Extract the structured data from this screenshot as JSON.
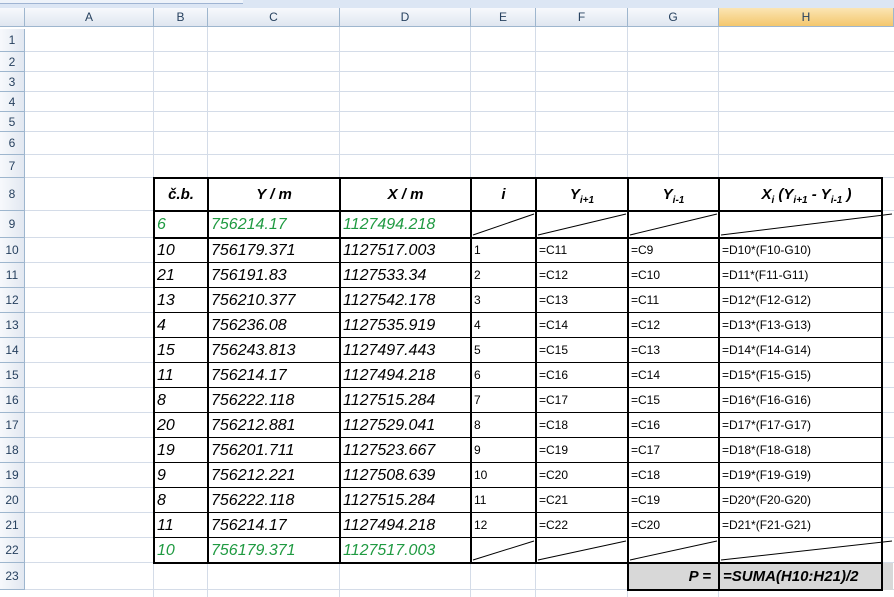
{
  "columns": [
    "A",
    "B",
    "C",
    "D",
    "E",
    "F",
    "G",
    "H"
  ],
  "selected_column": "H",
  "rows": [
    "1",
    "2",
    "3",
    "4",
    "5",
    "6",
    "7",
    "8",
    "9",
    "10",
    "11",
    "12",
    "13",
    "14",
    "15",
    "16",
    "17",
    "18",
    "19",
    "20",
    "21",
    "22",
    "23"
  ],
  "table": {
    "header": {
      "cb": "č.b.",
      "y": "Y / m",
      "x": "X / m",
      "i": "i",
      "yi1_main": "Y",
      "yi1_sub": "i+1",
      "yim1_main": "Y",
      "yim1_sub": "i-1",
      "h_xi": "X",
      "h_xi_sub": "i",
      "h_open": " (Y",
      "h_sub1": "i+1",
      "h_mid": " - Y",
      "h_sub2": "i-1",
      "h_close": " )"
    },
    "data_rows": [
      {
        "cb": "6",
        "y": "756214.17",
        "x": "1127494.218",
        "i": "",
        "f": "",
        "g": "",
        "h": "",
        "green": true
      },
      {
        "cb": "10",
        "y": "756179.371",
        "x": "1127517.003",
        "i": "1",
        "f": "=C11",
        "g": "=C9",
        "h": "=D10*(F10-G10)"
      },
      {
        "cb": "21",
        "y": "756191.83",
        "x": "1127533.34",
        "i": "2",
        "f": "=C12",
        "g": "=C10",
        "h": "=D11*(F11-G11)"
      },
      {
        "cb": "13",
        "y": "756210.377",
        "x": "1127542.178",
        "i": "3",
        "f": "=C13",
        "g": "=C11",
        "h": "=D12*(F12-G12)"
      },
      {
        "cb": "4",
        "y": "756236.08",
        "x": "1127535.919",
        "i": "4",
        "f": "=C14",
        "g": "=C12",
        "h": "=D13*(F13-G13)"
      },
      {
        "cb": "15",
        "y": "756243.813",
        "x": "1127497.443",
        "i": "5",
        "f": "=C15",
        "g": "=C13",
        "h": "=D14*(F14-G14)"
      },
      {
        "cb": "11",
        "y": "756214.17",
        "x": "1127494.218",
        "i": "6",
        "f": "=C16",
        "g": "=C14",
        "h": "=D15*(F15-G15)"
      },
      {
        "cb": "8",
        "y": "756222.118",
        "x": "1127515.284",
        "i": "7",
        "f": "=C17",
        "g": "=C15",
        "h": "=D16*(F16-G16)"
      },
      {
        "cb": "20",
        "y": "756212.881",
        "x": "1127529.041",
        "i": "8",
        "f": "=C18",
        "g": "=C16",
        "h": "=D17*(F17-G17)"
      },
      {
        "cb": "19",
        "y": "756201.711",
        "x": "1127523.667",
        "i": "9",
        "f": "=C19",
        "g": "=C17",
        "h": "=D18*(F18-G18)"
      },
      {
        "cb": "9",
        "y": "756212.221",
        "x": "1127508.639",
        "i": "10",
        "f": "=C20",
        "g": "=C18",
        "h": "=D19*(F19-G19)"
      },
      {
        "cb": "8",
        "y": "756222.118",
        "x": "1127515.284",
        "i": "11",
        "f": "=C21",
        "g": "=C19",
        "h": "=D20*(F20-G20)"
      },
      {
        "cb": "11",
        "y": "756214.17",
        "x": "1127494.218",
        "i": "12",
        "f": "=C22",
        "g": "=C20",
        "h": "=D21*(F21-G21)"
      },
      {
        "cb": "10",
        "y": "756179.371",
        "x": "1127517.003",
        "i": "",
        "f": "",
        "g": "",
        "h": "",
        "green": true
      }
    ],
    "sum_label": "P =",
    "sum_formula": "=SUMA(H10:H21)/2"
  },
  "colors": {
    "green_text": "#1f9a41",
    "selected_header": "#f4c76d",
    "sum_fill": "#d8d8d8"
  }
}
